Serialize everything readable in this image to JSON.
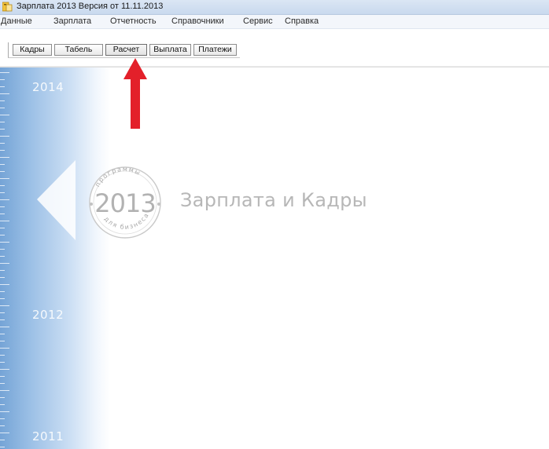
{
  "window": {
    "title": "Зарплата 2013 Версия от 11.11.2013",
    "icon": "app-icon"
  },
  "menu": {
    "items": [
      "Данные",
      "Зарплата",
      "Отчетность",
      "Справочники",
      "Сервис",
      "Справка"
    ]
  },
  "toolbar": {
    "buttons": [
      "Кадры",
      "Табель",
      "Расчет",
      "Выплата",
      "Платежи"
    ],
    "highlighted": "Расчет"
  },
  "splash": {
    "years": [
      "2014",
      "2012",
      "2011"
    ],
    "logo_top_text": "программы",
    "logo_year": "2013",
    "logo_bottom_text": "для бизнеса",
    "brand_name": "Зарплата и Кадры"
  },
  "colors": {
    "pointer_arrow": "#e3202a",
    "strip_blue": "#75a4d6",
    "brand_text": "#b7b7b7"
  }
}
